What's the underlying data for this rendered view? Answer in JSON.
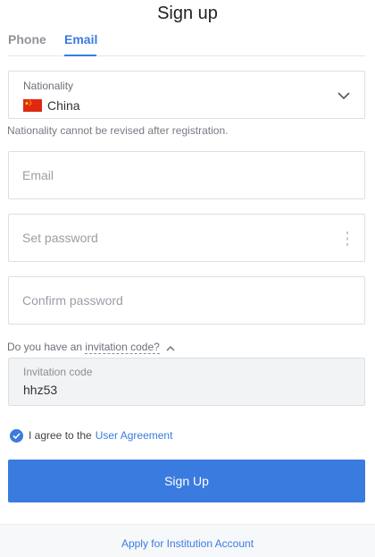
{
  "header": {
    "title": "Sign up"
  },
  "tabs": [
    {
      "label": "Phone",
      "active": false
    },
    {
      "label": "Email",
      "active": true
    }
  ],
  "nationality": {
    "label": "Nationality",
    "value": "China",
    "flag_icon": "china-flag-icon",
    "hint": "Nationality cannot be revised after registration."
  },
  "fields": {
    "email": {
      "placeholder": "Email",
      "value": ""
    },
    "password": {
      "placeholder": "Set password",
      "value": ""
    },
    "confirm": {
      "placeholder": "Confirm password",
      "value": ""
    }
  },
  "invitation": {
    "question_prefix": "Do you have an",
    "question_link": "invitation code?",
    "label": "Invitation code",
    "value": "hhz53"
  },
  "agreement": {
    "checked": true,
    "text": "I agree to the",
    "link": "User Agreement"
  },
  "actions": {
    "signup_label": "Sign Up",
    "institution_link": "Apply for Institution Account"
  },
  "colors": {
    "accent": "#3a7be0",
    "border": "#dcdfe6",
    "readonly_bg": "#f2f3f5"
  }
}
